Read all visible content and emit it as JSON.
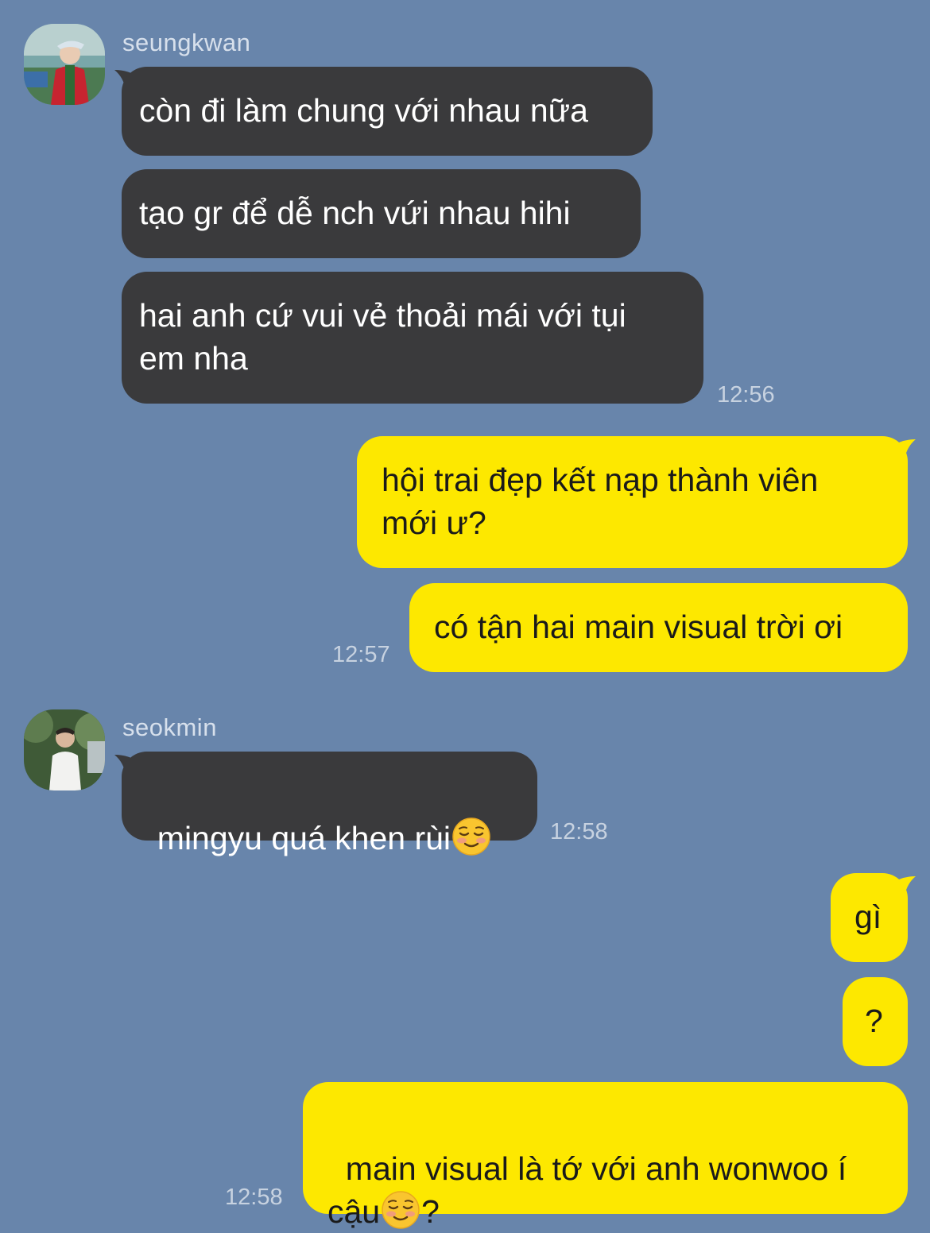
{
  "colors": {
    "background": "#6885ab",
    "incoming_bubble": "#3a3a3c",
    "outgoing_bubble": "#fde800"
  },
  "groups": [
    {
      "sender": "seungkwan",
      "messages": [
        "còn đi làm chung với nhau nữa",
        "tạo gr để dễ nch vứi nhau hihi",
        "hai anh cứ vui vẻ thoải mái với tụi\nem nha"
      ],
      "time": "12:56"
    },
    {
      "sender": "me",
      "messages": [
        "hội trai đẹp kết nạp thành viên\nmới ư?",
        "có tận hai main visual trời ơi"
      ],
      "time": "12:57"
    },
    {
      "sender": "seokmin",
      "messages": [
        {
          "before": "mingyu quá khen rùi",
          "emoji": "smiling-blush-emoji",
          "after": ""
        }
      ],
      "time": "12:58"
    },
    {
      "sender": "me",
      "messages": [
        "gì",
        "?",
        {
          "before": "main visual là tớ với anh wonwoo í\ncậu",
          "emoji": "smiling-blush-emoji",
          "after": "?"
        }
      ],
      "time": "12:58"
    }
  ]
}
